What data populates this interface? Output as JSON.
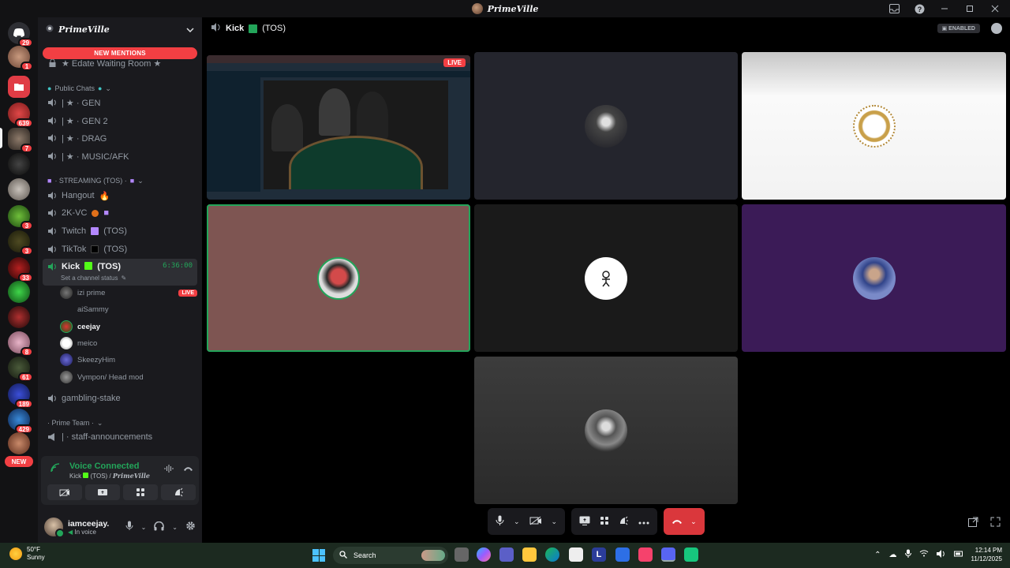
{
  "window": {
    "title": "PrimeVille"
  },
  "server": {
    "name": "PrimeVille",
    "new_mentions": "NEW MENTIONS",
    "waiting_room": "★ Edate Waiting Room ★",
    "new_badge": "NEW"
  },
  "server_rail": {
    "badges": [
      "29",
      "1",
      "639",
      "7",
      "3",
      "3",
      "33",
      "8",
      "61",
      "189",
      "429"
    ]
  },
  "channels": {
    "public_category": "Public Chats",
    "public": [
      "| ★ · GEN",
      "| ★ · GEN 2",
      "| ★ · DRAG",
      "| ★ · MUSIC/AFK"
    ],
    "streaming_category": "· STREAMING (TOS) ·",
    "hangout": "Hangout",
    "k2vc": "2K-VC",
    "twitch": "Twitch",
    "twitch_tos": "(TOS)",
    "tiktok": "TikTok",
    "tiktok_tos": "(TOS)",
    "kick": "Kick",
    "kick_tos": "(TOS)",
    "kick_timer": "6:36:00",
    "kick_status": "Set a channel status",
    "gambling": "gambling-stake",
    "prime_team_category": "· Prime Team ·",
    "staff": "| · staff-announcements"
  },
  "voice_members": [
    {
      "name": "izi prime",
      "live": "LIVE",
      "bold": false
    },
    {
      "name": "aiSammy",
      "live": "",
      "bold": false
    },
    {
      "name": "ceejay",
      "live": "",
      "bold": true
    },
    {
      "name": "meico",
      "live": "",
      "bold": false
    },
    {
      "name": "SkeezyHim",
      "live": "",
      "bold": false
    },
    {
      "name": "Vympon/ Head mod",
      "live": "",
      "bold": false
    }
  ],
  "voice_panel": {
    "title": "Voice Connected",
    "channel": "Kick",
    "tos": "(TOS) /",
    "server": "PrimeVille"
  },
  "user": {
    "name": "iamceejay.",
    "status": "In voice"
  },
  "main_header": {
    "channel": "Kick",
    "tos": "(TOS)",
    "enabled": "ENABLED"
  },
  "stream": {
    "live": "LIVE"
  },
  "taskbar": {
    "temp": "50°F",
    "weather": "Sunny",
    "search": "Search",
    "time": "12:14 PM",
    "date": "11/12/2025"
  },
  "colors": {
    "accent_green": "#23a55a",
    "danger_red": "#f23f43",
    "kick_green": "#53fc18",
    "twitch_purple": "#b388ff"
  }
}
